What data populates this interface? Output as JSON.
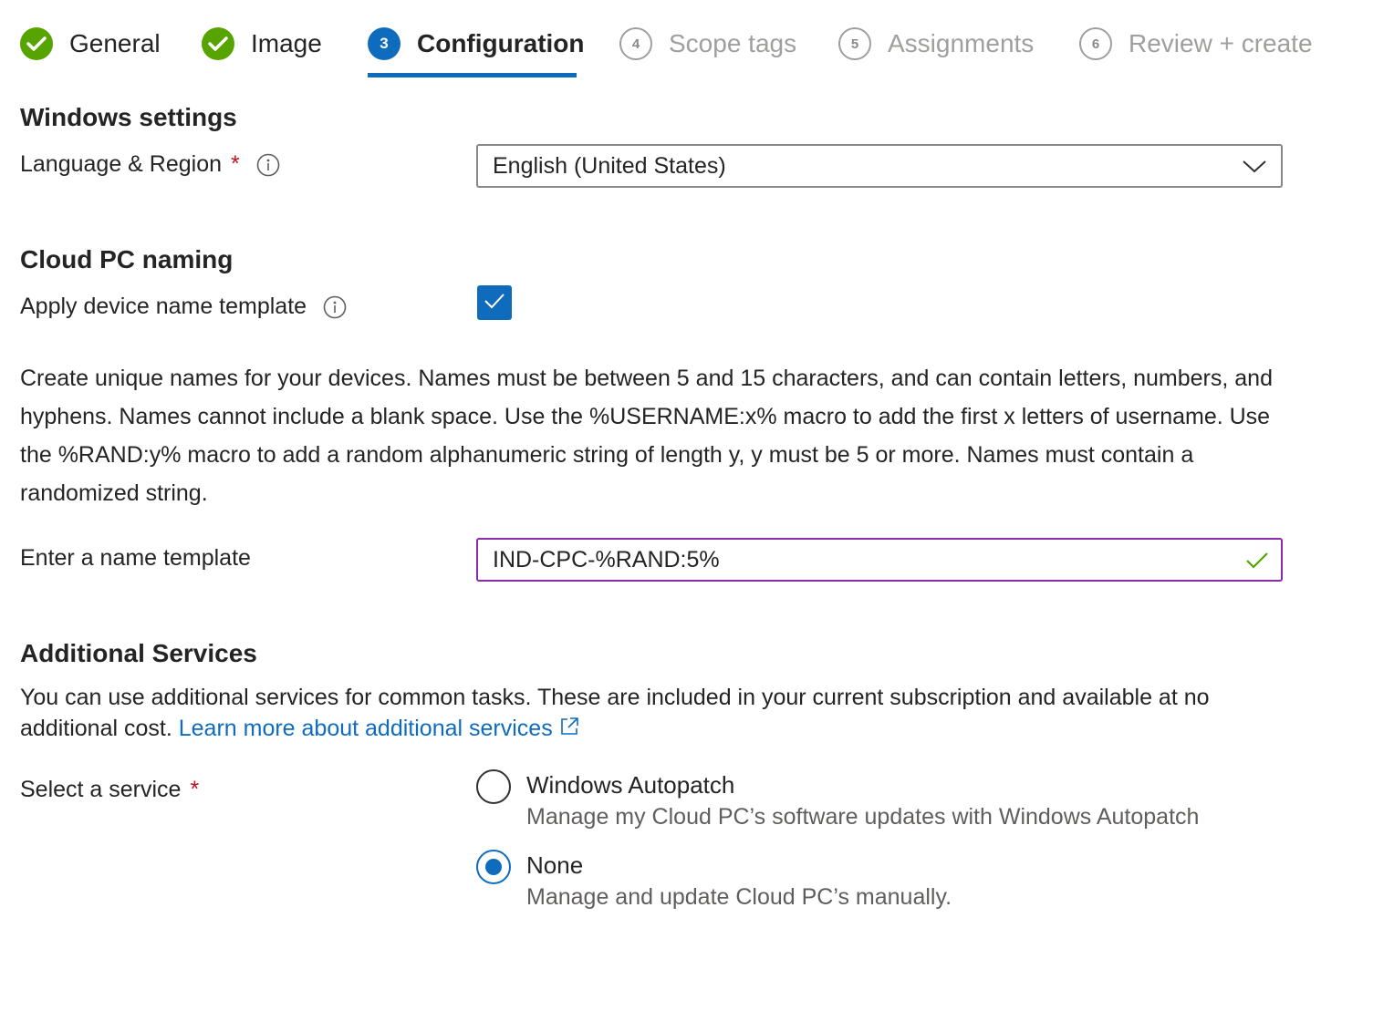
{
  "wizard": {
    "steps": [
      {
        "number": "",
        "label": "General",
        "state": "done"
      },
      {
        "number": "",
        "label": "Image",
        "state": "done"
      },
      {
        "number": "3",
        "label": "Configuration",
        "state": "current"
      },
      {
        "number": "4",
        "label": "Scope tags",
        "state": "todo"
      },
      {
        "number": "5",
        "label": "Assignments",
        "state": "todo"
      },
      {
        "number": "6",
        "label": "Review + create",
        "state": "todo"
      }
    ]
  },
  "windows_settings": {
    "title": "Windows settings",
    "language_label": "Language & Region",
    "required_mark": "*",
    "language_value": "English (United States)"
  },
  "naming": {
    "title": "Cloud PC naming",
    "apply_template_label": "Apply device name template",
    "apply_template_checked": true,
    "description": "Create unique names for your devices. Names must be between 5 and 15 characters, and can contain letters, numbers, and hyphens. Names cannot include a blank space. Use the %USERNAME:x% macro to add the first x letters of username. Use the %RAND:y% macro to add a random alphanumeric string of length y, y must be 5 or more. Names must contain a randomized string.",
    "template_label": "Enter a name template",
    "template_value": "IND-CPC-%RAND:5%"
  },
  "additional_services": {
    "title": "Additional Services",
    "description": "You can use additional services for common tasks. These are included in your current subscription and available at no additional cost.",
    "link_text": "Learn more about additional services",
    "select_label": "Select a service",
    "required_mark": "*",
    "options": [
      {
        "title": "Windows Autopatch",
        "subtitle": "Manage my Cloud PC’s software updates with Windows Autopatch",
        "selected": false
      },
      {
        "title": "None",
        "subtitle": "Manage and update Cloud PC’s manually.",
        "selected": true
      }
    ]
  },
  "colors": {
    "accent": "#0f6cbd",
    "success": "#57a300",
    "required": "#c50f1f",
    "focus_border": "#8a2ba8"
  }
}
